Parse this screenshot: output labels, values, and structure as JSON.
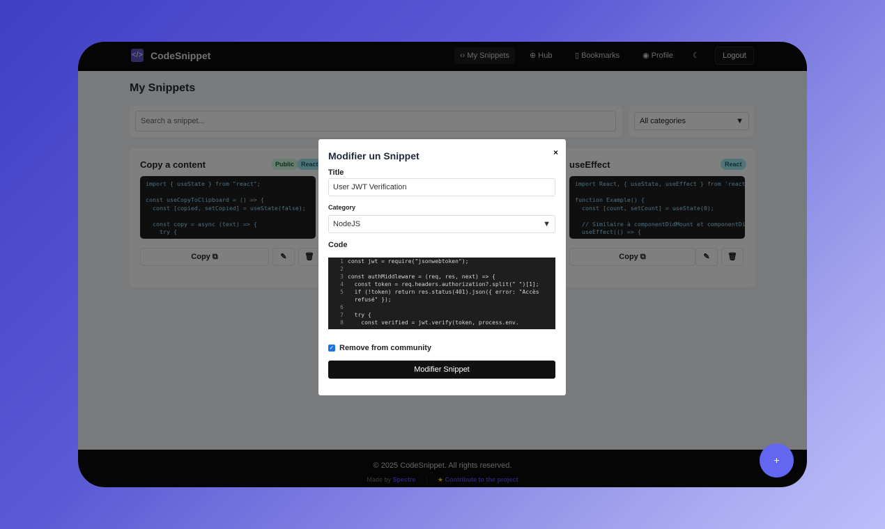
{
  "nav": {
    "brand": "CodeSnippet",
    "items": [
      {
        "label": "My Snippets",
        "icon": "code-icon"
      },
      {
        "label": "Hub",
        "icon": "globe-icon"
      },
      {
        "label": "Bookmarks",
        "icon": "bookmark-icon"
      },
      {
        "label": "Profile",
        "icon": "user-icon"
      }
    ],
    "theme_icon": "moon-icon",
    "logout": "Logout"
  },
  "page": {
    "title": "My Snippets",
    "search_placeholder": "Search a snippet...",
    "category": "All categories"
  },
  "cards": [
    {
      "title": "Copy a content",
      "badges": [
        "Public",
        "React"
      ],
      "code": "import { useState } from \"react\";\n\nconst useCopyToClipboard = () => {\n  const [copied, setCopied] = useState(false);\n\n  const copy = async (text) => {\n    try {",
      "copy": "Copy"
    },
    {
      "title": "useEffect",
      "badges": [
        "React"
      ],
      "code": "import React, { useState, useEffect } from 'react';\n\nfunction Example() {\n  const [count, setCount] = useState(0);\n\n  // Similaire à componentDidMount et componentDidUp\n  useEffect(() => {",
      "copy": "Copy"
    }
  ],
  "modal": {
    "title": "Modifier un Snippet",
    "close": "×",
    "title_label": "Title",
    "title_value": "User JWT Verification",
    "category_label": "Category",
    "category_value": "NodeJS",
    "code_label": "Code",
    "code_lines": [
      [
        "1",
        "const jwt = require(\"jsonwebtoken\");"
      ],
      [
        "2",
        ""
      ],
      [
        "3",
        "const authMiddleware = (req, res, next) => {"
      ],
      [
        "4",
        "  const token = req.headers.authorization?.split(\" \")[1];"
      ],
      [
        "5",
        "  if (!token) return res.status(401).json({ error: \"Accès"
      ],
      [
        "",
        "  refusé\" });"
      ],
      [
        "6",
        ""
      ],
      [
        "7",
        "  try {"
      ],
      [
        "8",
        "    const verified = jwt.verify(token, process.env."
      ]
    ],
    "checkbox_label": "Remove from community",
    "checked": true,
    "submit": "Modifier Snippet"
  },
  "footer": {
    "copyright": "© 2025 CodeSnippet. All rights reserved.",
    "made_by": "Made by",
    "author": "Spectre",
    "contribute": "Contribute to the project"
  },
  "fab": "+",
  "colors": {
    "accent": "#6366f1",
    "nav": "#0a0a0a"
  }
}
